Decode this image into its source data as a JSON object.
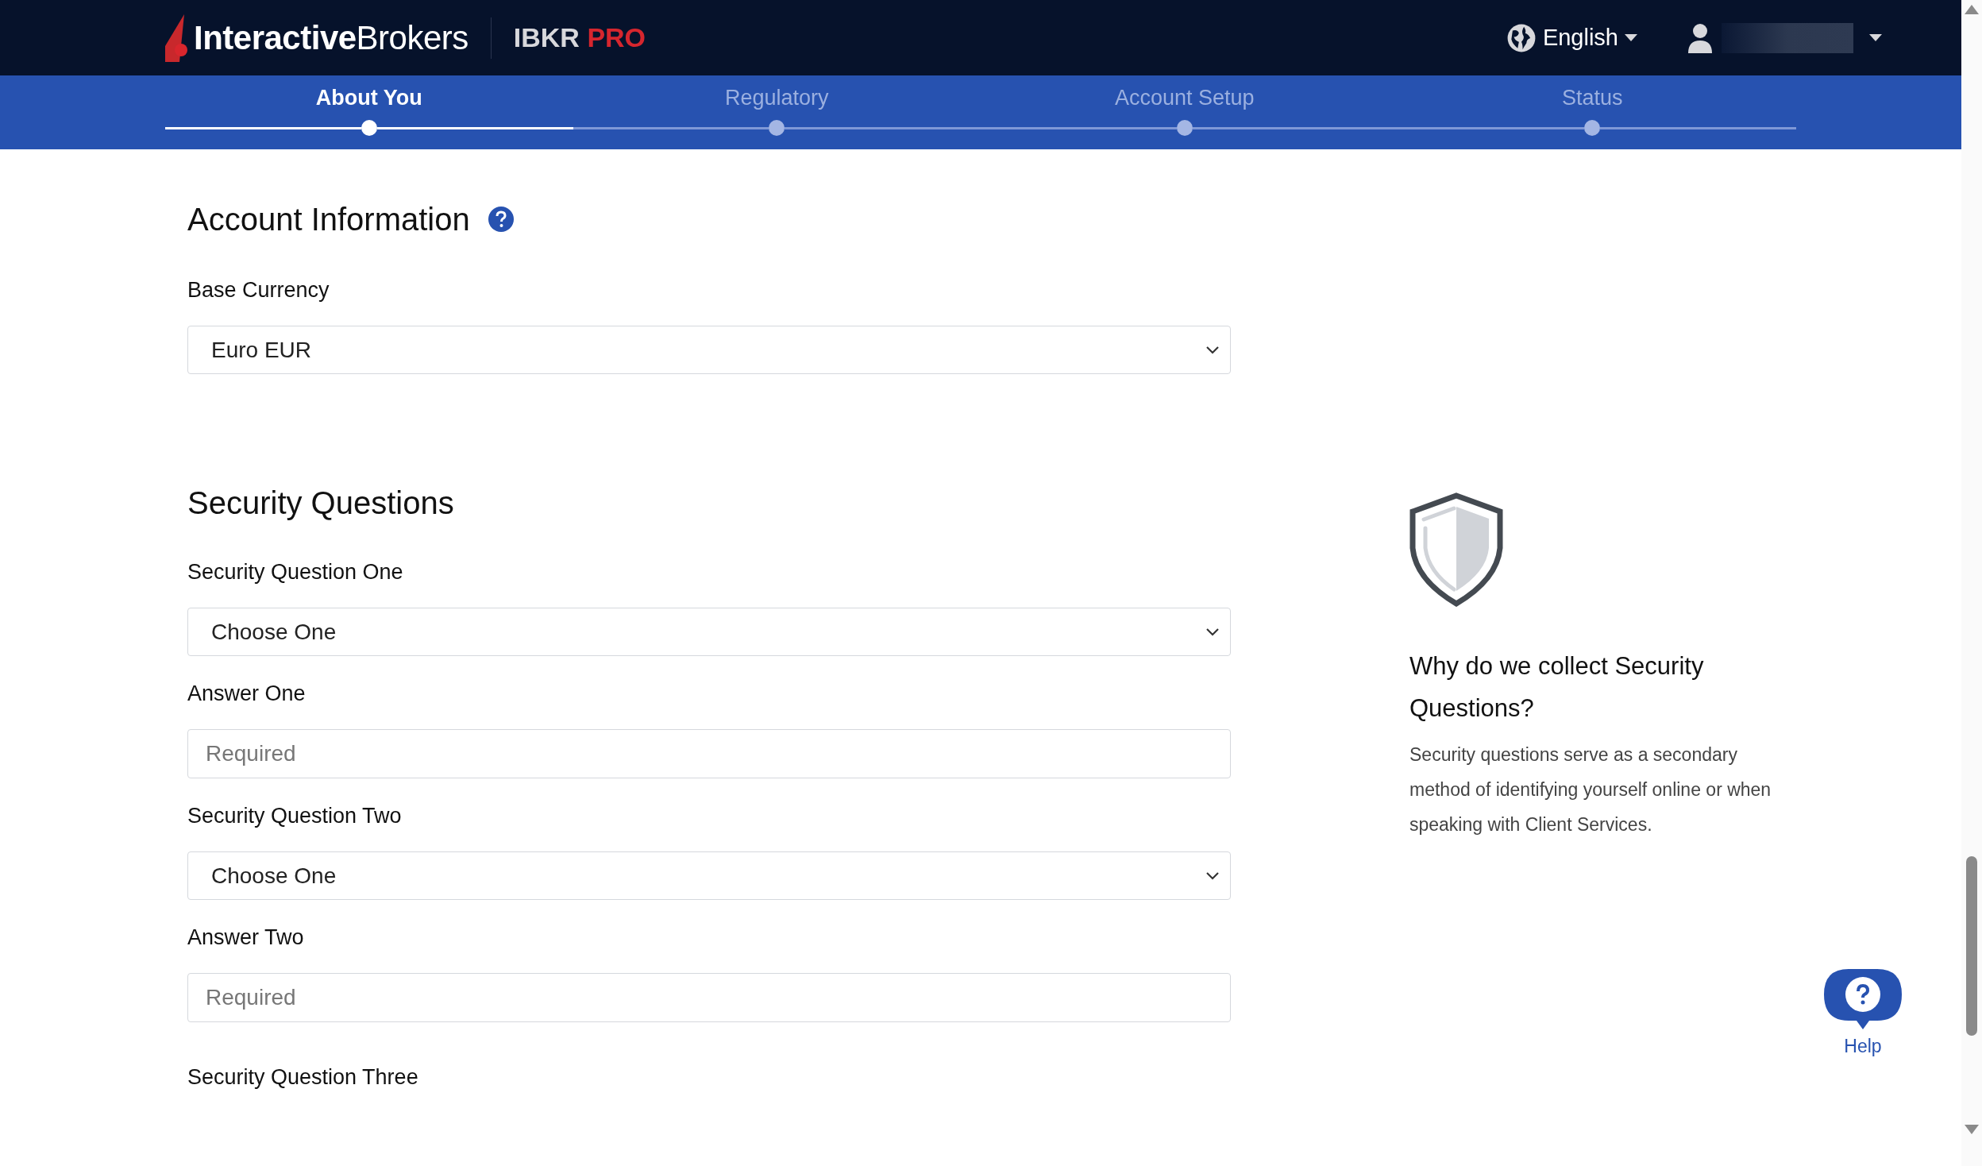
{
  "header": {
    "logo": {
      "bold": "Interactive",
      "light": "Brokers"
    },
    "product": {
      "name": "IBKR",
      "tier": "PRO"
    },
    "language": "English"
  },
  "steps": [
    {
      "label": "About You",
      "selected": true
    },
    {
      "label": "Regulatory",
      "selected": false
    },
    {
      "label": "Account Setup",
      "selected": false
    },
    {
      "label": "Status",
      "selected": false
    }
  ],
  "account_information": {
    "title": "Account Information",
    "fields": [
      {
        "kind": "select",
        "label": "Base Currency",
        "value": "Euro EUR"
      }
    ]
  },
  "security_questions": {
    "title": "Security Questions",
    "fields": [
      {
        "kind": "select",
        "label": "Security Question One",
        "value": "Choose One"
      },
      {
        "kind": "input",
        "label": "Answer One",
        "placeholder": "Required"
      },
      {
        "kind": "select",
        "label": "Security Question Two",
        "value": "Choose One"
      },
      {
        "kind": "input",
        "label": "Answer Two",
        "placeholder": "Required"
      },
      {
        "kind": "label",
        "label": "Security Question Three"
      }
    ]
  },
  "side_info": {
    "title": "Why do we collect Security Questions?",
    "text": "Security questions serve as a secondary method of identifying yourself online or when speaking with Client Services."
  },
  "help": {
    "label": "Help"
  }
}
